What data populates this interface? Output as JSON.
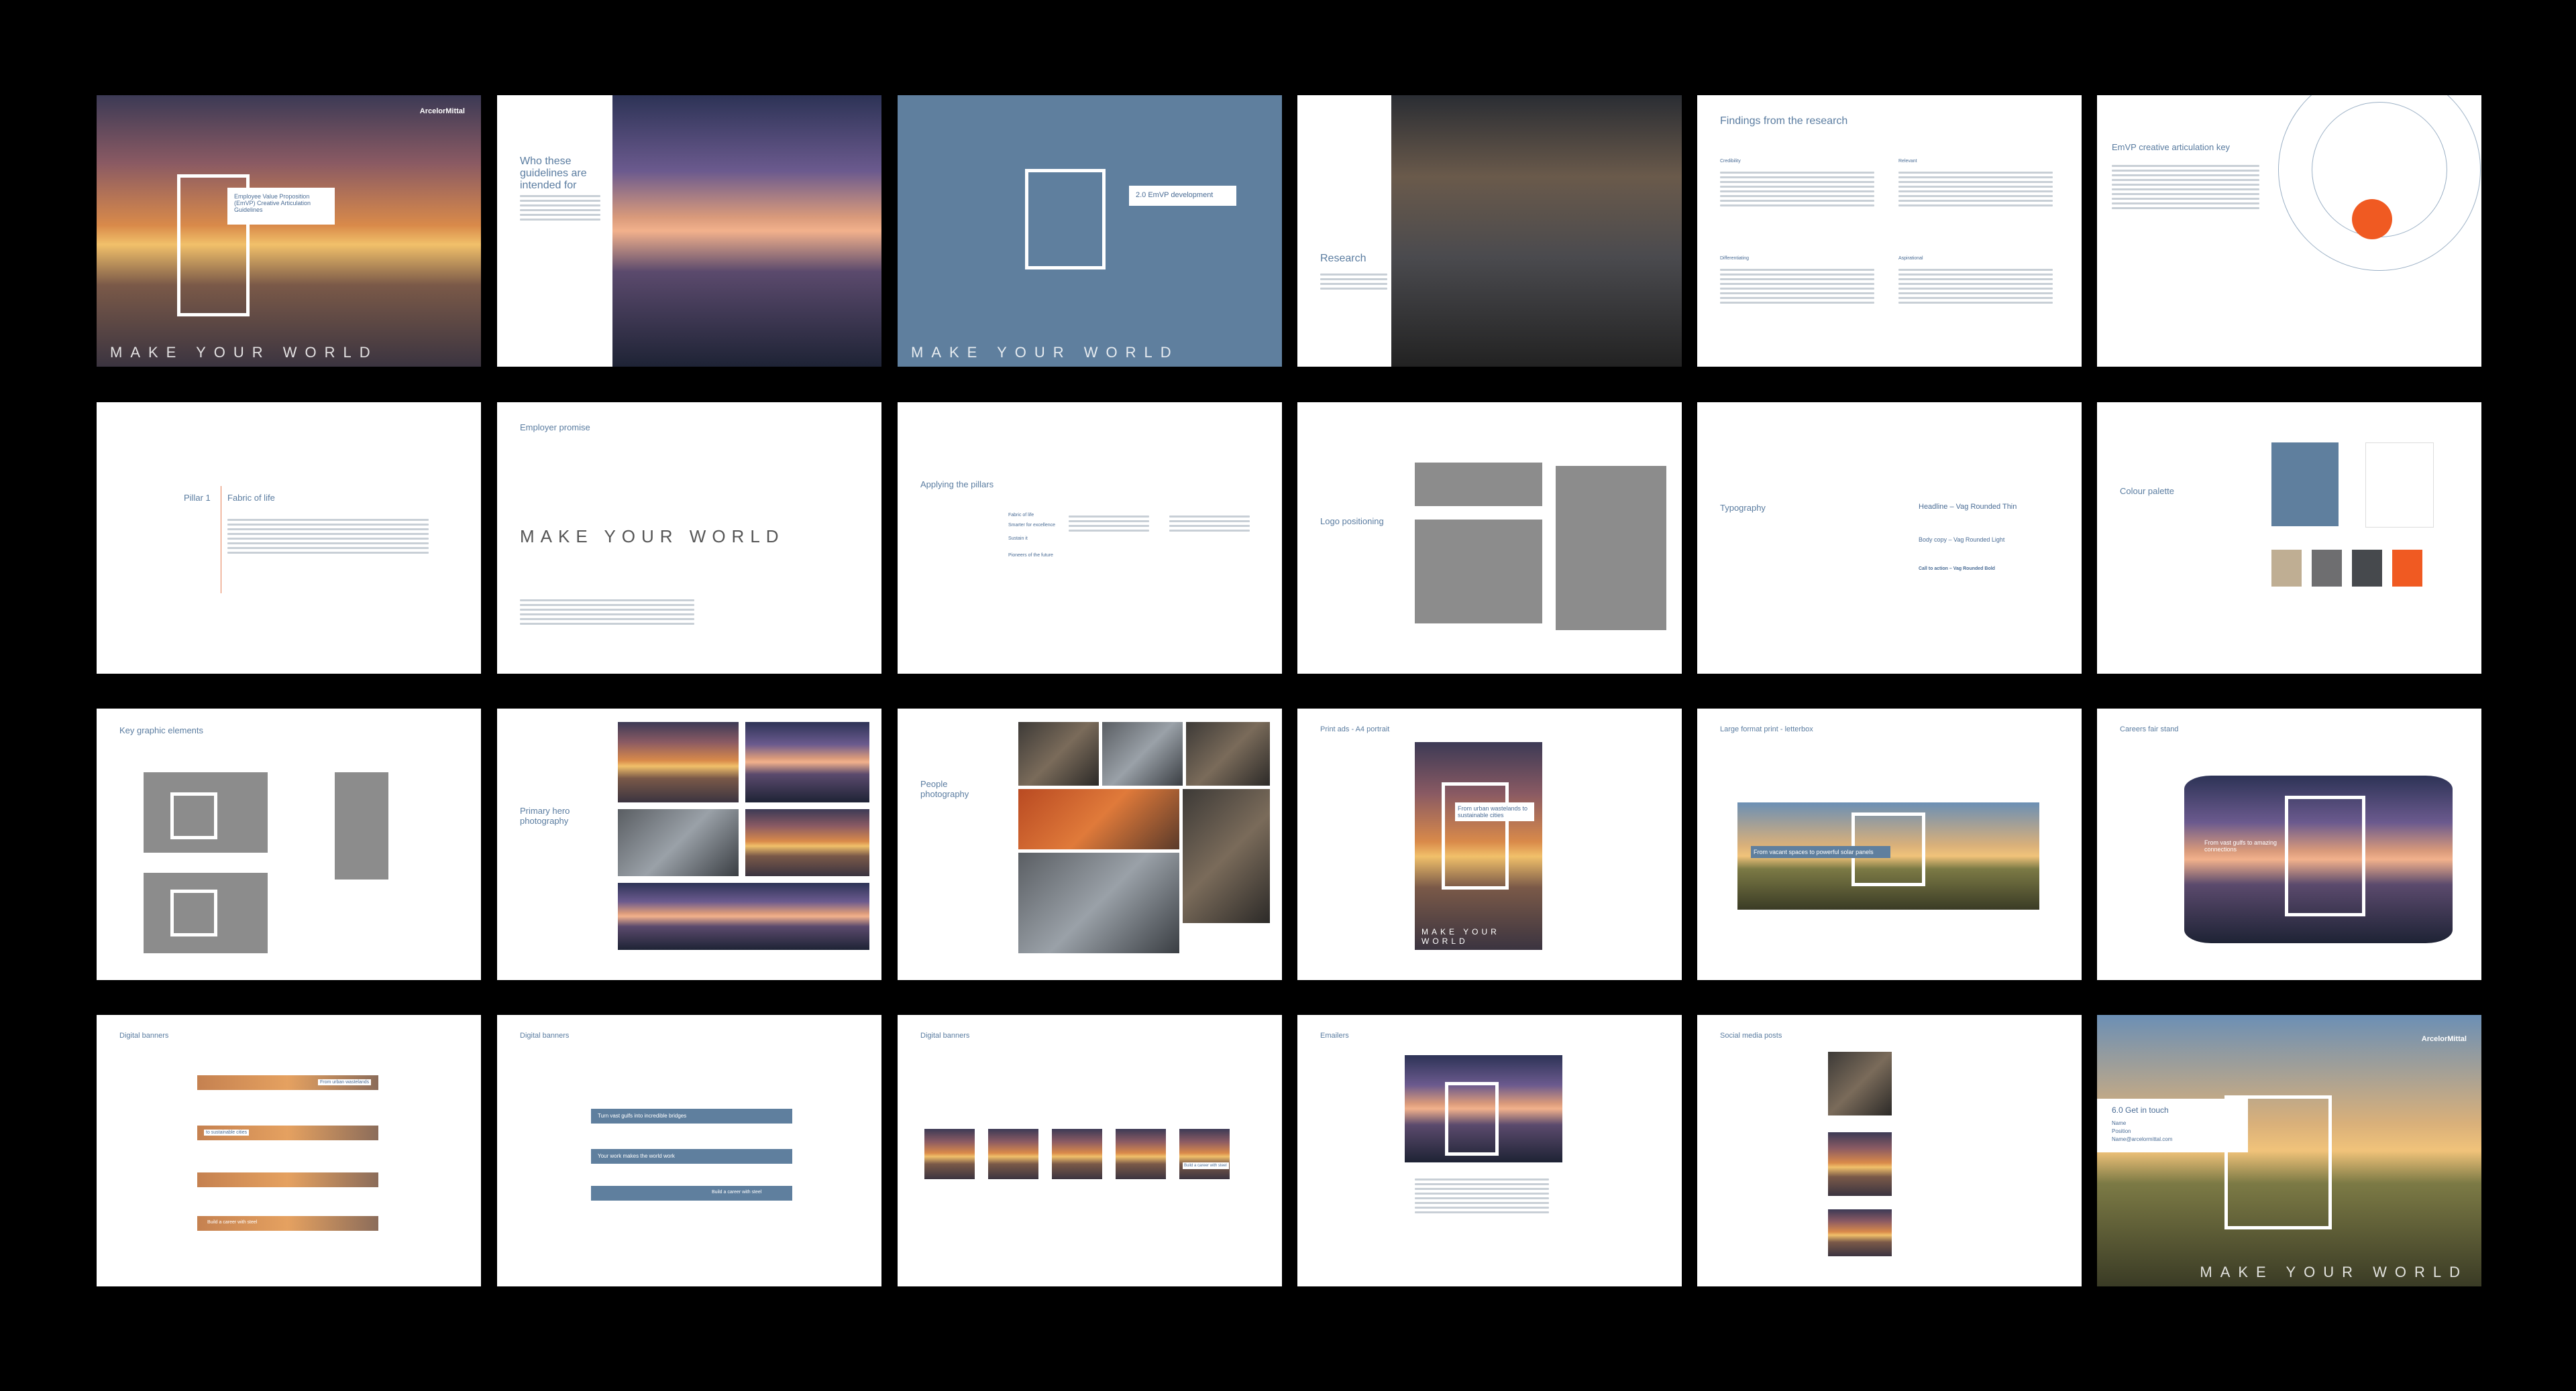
{
  "brand": {
    "logo_text": "ArcelorMittal",
    "tagline": "MAKE YOUR WORLD",
    "colors": {
      "blue": "#5f7f9e",
      "orange": "#f05a22",
      "sand": "#bfae93",
      "gray": "#6e6e70",
      "dark": "#46494d"
    }
  },
  "spreads": {
    "cover": {
      "title": "Employee Value Proposition (EmVP) Creative Articulation Guidelines"
    },
    "who": {
      "title": "Who these guidelines are intended for"
    },
    "development": {
      "title": "2.0 EmVP development"
    },
    "research": {
      "title": "Research"
    },
    "findings": {
      "title": "Findings from the research",
      "headings": [
        "Credibility",
        "Relevant",
        "Differentiating",
        "Aspirational"
      ]
    },
    "key": {
      "title": "EmVP creative articulation key"
    },
    "pillar": {
      "label": "Pillar 1",
      "title": "Fabric of life"
    },
    "promise": {
      "title": "Employer promise"
    },
    "pillars": {
      "title": "Applying the pillars",
      "items": [
        "Fabric of life",
        "Smarter for excellence",
        "Sustain it",
        "Pioneers of the future"
      ]
    },
    "logo": {
      "title": "Logo positioning"
    },
    "typography": {
      "title": "Typography",
      "headline": "Headline – Vag Rounded Thin",
      "body": "Body copy – Vag Rounded Light",
      "cta": "Call to action – Vag Rounded Bold"
    },
    "colour": {
      "title": "Colour palette"
    },
    "graphic": {
      "title": "Key graphic elements"
    },
    "hero": {
      "title": "Primary hero photography"
    },
    "people": {
      "title": "People photography"
    },
    "print": {
      "title": "Print ads - A4 portrait",
      "headline": "From urban wastelands to sustainable cities"
    },
    "letterbox": {
      "title": "Large format print - letterbox",
      "headline": "From vacant spaces to powerful solar panels"
    },
    "stand": {
      "title": "Careers fair stand",
      "headline": "From vast gulfs to amazing connections"
    },
    "banners1": {
      "title": "Digital banners",
      "ctas": [
        "From urban wastelands",
        "to sustainable cities",
        "Build a career with steel"
      ]
    },
    "banners2": {
      "title": "Digital banners",
      "lines": [
        "Turn vast gulfs into incredible bridges",
        "Your work makes the world work",
        "Build a career with steel"
      ]
    },
    "banners3": {
      "title": "Digital banners",
      "cta": "Build a career with steel"
    },
    "emailers": {
      "title": "Emailers"
    },
    "social": {
      "title": "Social media posts"
    },
    "contact": {
      "title": "6.0 Get in touch",
      "name": "Name",
      "position": "Position",
      "email": "Name@arcelormittal.com"
    }
  }
}
